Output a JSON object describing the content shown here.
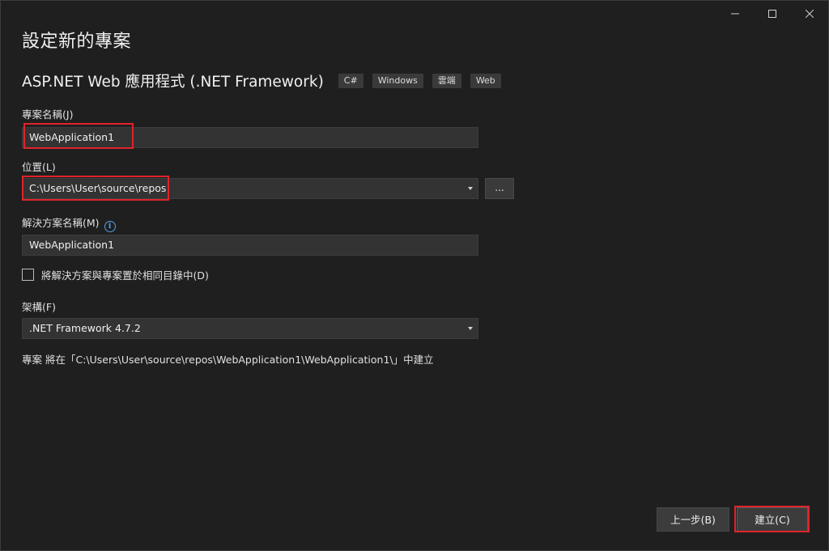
{
  "window": {
    "controls": [
      {
        "name": "minimize-icon"
      },
      {
        "name": "maximize-icon"
      },
      {
        "name": "close-icon"
      }
    ]
  },
  "page_title": "設定新的專案",
  "template": {
    "name": "ASP.NET Web 應用程式 (.NET Framework)",
    "tags": [
      "C#",
      "Windows",
      "雲端",
      "Web"
    ]
  },
  "project_name": {
    "label": "專案名稱(J)",
    "value": "WebApplication1"
  },
  "location": {
    "label": "位置(L)",
    "value": "C:\\Users\\User\\source\\repos",
    "browse_label": "..."
  },
  "solution_name": {
    "label": "解決方案名稱(M)",
    "value": "WebApplication1",
    "info_icon": "info-icon"
  },
  "same_directory": {
    "label": "將解決方案與專案置於相同目錄中(D)",
    "checked": false
  },
  "framework": {
    "label": "架構(F)",
    "value": ".NET Framework 4.7.2"
  },
  "path_note": "專案 將在「C:\\Users\\User\\source\\repos\\WebApplication1\\WebApplication1\\」中建立",
  "footer": {
    "back_label": "上一步(B)",
    "create_label": "建立(C)"
  },
  "colors": {
    "background": "#1f1f1f",
    "input_background": "#333333",
    "highlight": "#e0232b",
    "info_accent": "#4fa3e8"
  }
}
